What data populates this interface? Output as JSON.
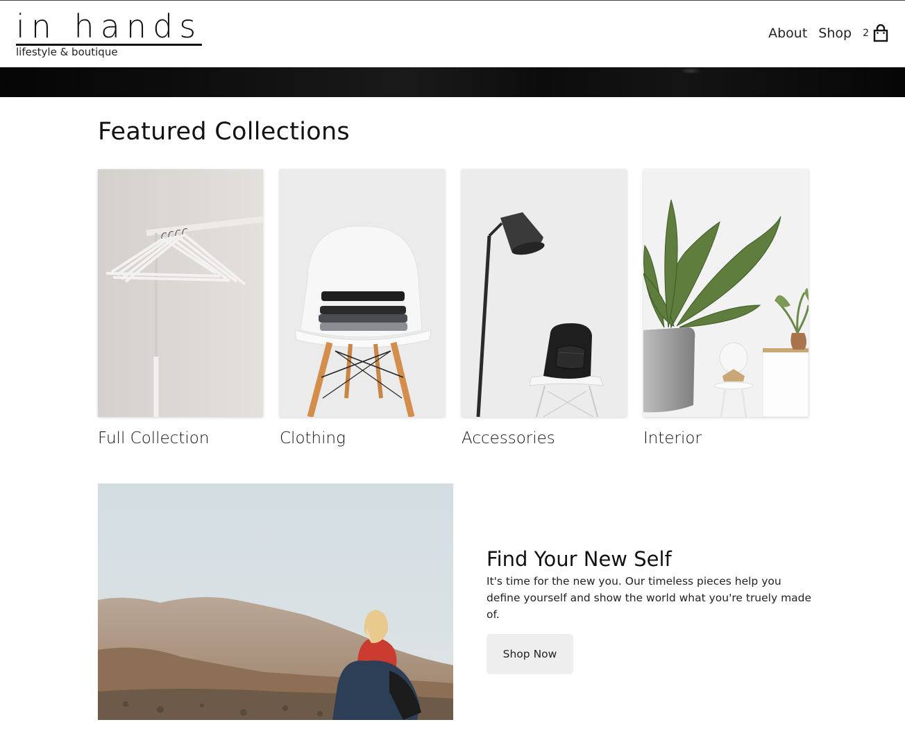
{
  "header": {
    "logo_title": "in hands",
    "logo_tagline": "lifestyle & boutique",
    "nav": {
      "about": "About",
      "shop": "Shop"
    },
    "cart_count": "2"
  },
  "featured": {
    "title": "Featured Collections",
    "collections": [
      {
        "label": "Full Collection",
        "image": "clothes-hangers-on-rack"
      },
      {
        "label": "Clothing",
        "image": "folded-clothes-on-chair"
      },
      {
        "label": "Accessories",
        "image": "floor-lamp-and-backpack"
      },
      {
        "label": "Interior",
        "image": "potted-plants"
      }
    ]
  },
  "promo": {
    "image": "woman-in-red-sweater-desert-mountains",
    "title": "Find Your New Self",
    "body": "It's time for the new you. Our timeless pieces help you define yourself and show the world what you're truely made of.",
    "button": "Shop Now"
  },
  "colors": {
    "text": "#111111",
    "button_bg": "#eeeeee",
    "band": "#0a0a0a"
  }
}
